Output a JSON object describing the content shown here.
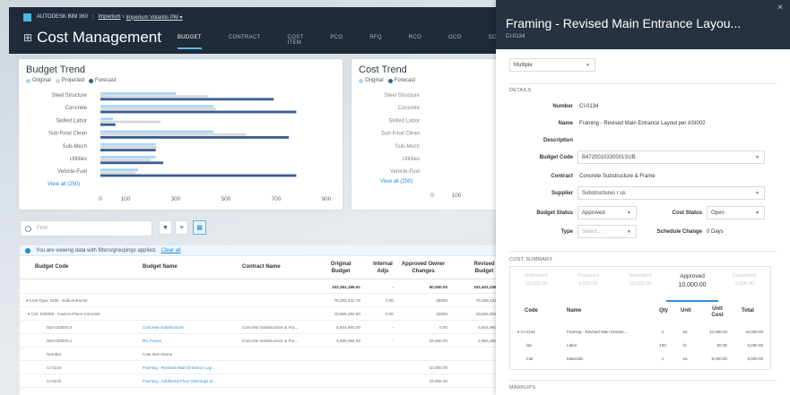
{
  "header": {
    "brand": "AUTODESK BIM 360",
    "project_prefix": "Imperium",
    "project_sep": "›",
    "project_name": "Imperium Volantis PM ▾",
    "app_title": "Cost Management",
    "tabs": [
      "BUDGET",
      "CONTRACT",
      "COST ITEM",
      "PCO",
      "RFQ",
      "RCO",
      "OCO",
      "SCO"
    ]
  },
  "budget_trend": {
    "title": "Budget Trend",
    "legend": [
      "Original",
      "Projected",
      "Forecast"
    ],
    "view_all": "View all (250)"
  },
  "cost_trend": {
    "title": "Cost Trend",
    "legend": [
      "Original",
      "Forecast"
    ],
    "view_all": "View all (250)"
  },
  "colors": {
    "original": "#a9d6f2",
    "projected": "#d4d9de",
    "forecast": "#3a5d8f",
    "accent": "#1f8ad2"
  },
  "chart_data": [
    {
      "type": "bar",
      "orientation": "horizontal",
      "title": "Budget Trend",
      "categories": [
        "Steel Structure",
        "Concrete",
        "Skilled Labor",
        "Sub-Final Clean",
        "Sub-Mech",
        "Utilities",
        "Vehicle-Fuel"
      ],
      "series": [
        {
          "name": "Original",
          "values": [
            300,
            450,
            50,
            450,
            220,
            220,
            150
          ]
        },
        {
          "name": "Projected",
          "values": [
            430,
            460,
            240,
            580,
            225,
            200,
            140
          ]
        },
        {
          "name": "Forecast",
          "values": [
            690,
            780,
            60,
            750,
            220,
            250,
            780
          ]
        }
      ],
      "xticks": [
        "0",
        "100",
        "300",
        "500",
        "700",
        "900"
      ],
      "xlim": [
        0,
        900
      ]
    },
    {
      "type": "bar",
      "orientation": "horizontal",
      "title": "Cost Trend",
      "categories": [
        "Steel Structure",
        "Concrete",
        "Skilled Labor",
        "Sub-Final Clean",
        "Sub-Mech",
        "Utilities",
        "Vehicle-Fuel"
      ],
      "series": [
        {
          "name": "Original",
          "values": [
            0,
            0,
            0,
            0,
            0,
            0,
            0
          ]
        },
        {
          "name": "Forecast",
          "values": [
            0,
            0,
            0,
            0,
            0,
            0,
            0
          ]
        }
      ],
      "xticks": [
        "0",
        "100"
      ]
    }
  ],
  "toolbar": {
    "search_placeholder": "Find"
  },
  "banner": {
    "text": "You are viewing data with filters/groupings applied.",
    "clear": "Clear all"
  },
  "table": {
    "headers": {
      "budget_code": "Budget Code",
      "budget_name": "Budget Name",
      "contract_name": "Contract Name",
      "original_budget": "Original Budget",
      "internal_adjs": "Internal Adjs",
      "approved_owner": "Approved Owner Changes",
      "revised": "Revised Budget"
    },
    "rows": [
      {
        "code": "",
        "name": "",
        "contract": "",
        "orig": "102,351,186.91",
        "adj": "-",
        "appr": "50,050.00",
        "rev": "102,401,236.91",
        "kind": "total"
      },
      {
        "code": "▾ Cost Type: SUB - Subcontractor",
        "name": "",
        "contract": "",
        "orig": "76,250,432.75",
        "adj": "0.00",
        "appr": "39000",
        "rev": "76,289,432.75",
        "kind": "group"
      },
      {
        "code": "▾ CSI: 033000 - Cast-In-Place Concrete",
        "name": "",
        "contract": "",
        "orig": "10,555,352.00",
        "adj": "0.00",
        "appr": "33000",
        "rev": "10,555,352.00",
        "kind": "group"
      },
      {
        "code": "002-033000.0",
        "name": "Concrete Substructure",
        "contract": "Concrete Substructure & Fra...",
        "orig": "5,604,960.00",
        "adj": "-",
        "appr": "0.00",
        "rev": "5,604,960.00",
        "kind": "item"
      },
      {
        "code": "003-033000.1",
        "name": "RC Frame",
        "contract": "Concrete Substructure & Fra...",
        "orig": "4,950,392.00",
        "adj": "-",
        "appr": "33,000.00",
        "rev": "4,983,392.00",
        "kind": "item"
      },
      {
        "code": "Number",
        "name": "Cost Item Name",
        "contract": "",
        "orig": "",
        "adj": "",
        "appr": "",
        "rev": "",
        "kind": "sub"
      },
      {
        "code": "CI-0134",
        "name": "Framing - Revised Main Entrance Lay...",
        "contract": "",
        "orig": "",
        "adj": "",
        "appr": "10,000.00",
        "rev": "",
        "kind": "ci"
      },
      {
        "code": "CI-0132",
        "name": "Framing - Additional Floor Openings at ...",
        "contract": "",
        "orig": "",
        "adj": "",
        "appr": "23,000.00",
        "rev": "",
        "kind": "ci"
      }
    ]
  },
  "panel": {
    "title": "Framing - Revised Main Entrance Layou...",
    "id": "CI-0134",
    "close": "×",
    "scope": "Multiple",
    "details_label": "DETAILS",
    "fields": {
      "number_label": "Number",
      "number": "CI-0134",
      "name_label": "Name",
      "name": "Framing - Revised Main Entrance Layout per ASI002",
      "description_label": "Description",
      "budget_code_label": "Budget Code",
      "budget_code": "B4720010330001SUB",
      "contract_label": "Contract",
      "contract": "Concrete Substructure & Frame",
      "supplier_label": "Supplier",
      "supplier": "Substructures r us",
      "budget_status_label": "Budget Status",
      "budget_status": "Approved",
      "cost_status_label": "Cost Status",
      "cost_status": "Open",
      "type_label": "Type",
      "type_placeholder": "Select...",
      "schedule_change_label": "Schedule Change",
      "schedule_change": "0 Days"
    },
    "cost_summary_label": "COST SUMMARY",
    "summary": [
      {
        "label": "Estimated",
        "value": "10,000.00"
      },
      {
        "label": "Proposed",
        "value": "9,000.00"
      },
      {
        "label": "Submitted",
        "value": "10,000.00"
      },
      {
        "label": "Approved",
        "value": "10,000.00"
      },
      {
        "label": "Committed",
        "value": "9,000.00"
      }
    ],
    "summary_table": {
      "headers": [
        "Code",
        "Name",
        "Qty",
        "Unit",
        "Unit Cost",
        "Total"
      ],
      "rows": [
        [
          "▾ CI-0134",
          "Framing - Revised Main Entranc...",
          "1",
          "ea",
          "10,000.00",
          "10,000.00"
        ],
        [
          "lab",
          "Labor",
          "100",
          "hr",
          "50.00",
          "5,000.00"
        ],
        [
          "mat",
          "Materials",
          "1",
          "ea",
          "5,000.00",
          "5,000.00"
        ]
      ]
    },
    "markups_label": "MARKUPS"
  }
}
